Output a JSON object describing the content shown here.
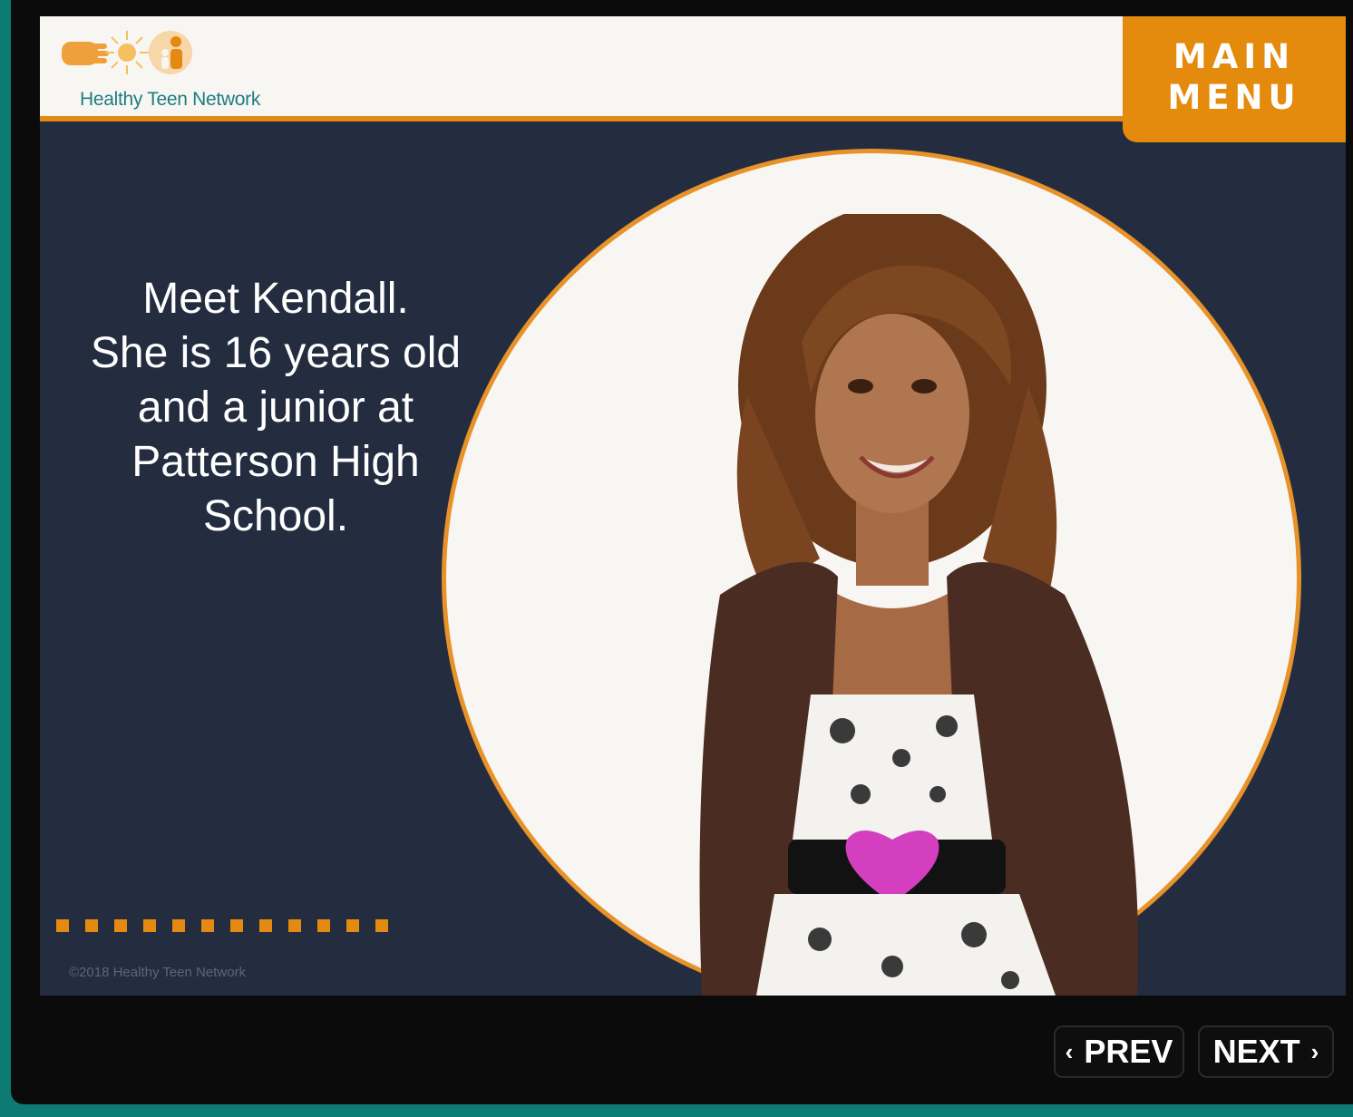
{
  "header": {
    "logo_text": "Healthy Teen Network",
    "menu_line1": "MAIN",
    "menu_line2": "MENU"
  },
  "slide": {
    "intro_lines": [
      "Meet Kendall.",
      "She is 16 years old",
      "and a junior at",
      "Patterson High",
      "School."
    ],
    "copyright": "©2018 Healthy Teen Network",
    "progress_total": 12
  },
  "nav": {
    "prev_label": "PREV",
    "next_label": "NEXT",
    "prev_icon": "chevron-left-icon",
    "next_icon": "chevron-right-icon"
  },
  "colors": {
    "accent": "#e48a0c",
    "slide_bg": "#232d3f",
    "header_bg": "#f8f6f2",
    "logo_text": "#1e7d83",
    "outer_frame": "#0d7a73"
  }
}
